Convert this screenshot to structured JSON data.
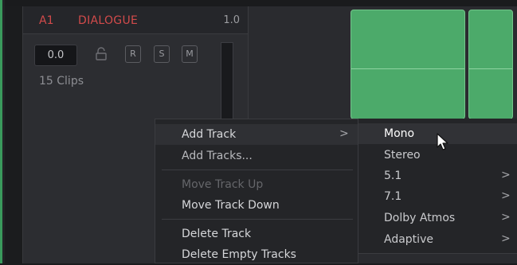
{
  "track": {
    "id": "A1",
    "name": "DIALOGUE",
    "volume_display": "1.0",
    "level_value": "0.0",
    "clip_count_label": "15 Clips",
    "buttons": {
      "r": "R",
      "s": "S",
      "m": "M"
    },
    "name_color": "#d24b4b"
  },
  "timeline": {
    "clip_color": "#4caa6a"
  },
  "context_menu": {
    "items": [
      {
        "label": "Add Track",
        "has_submenu": true,
        "state": "highlighted"
      },
      {
        "label": "Add Tracks...",
        "state": "normal"
      },
      {
        "label": "Move Track Up",
        "state": "disabled"
      },
      {
        "label": "Move Track Down",
        "state": "normal"
      },
      {
        "label": "Delete Track",
        "state": "normal"
      },
      {
        "label": "Delete Empty Tracks",
        "state": "normal"
      }
    ],
    "submenu_arrow": ">"
  },
  "submenu": {
    "items": [
      {
        "label": "Mono",
        "has_submenu": false,
        "state": "hovered"
      },
      {
        "label": "Stereo",
        "has_submenu": false
      },
      {
        "label": "5.1",
        "has_submenu": true
      },
      {
        "label": "7.1",
        "has_submenu": true
      },
      {
        "label": "Dolby Atmos",
        "has_submenu": true
      },
      {
        "label": "Adaptive",
        "has_submenu": true
      }
    ],
    "arrow": ">"
  },
  "icons": {
    "lock": "lock-icon",
    "cursor": "mouse-pointer-icon"
  }
}
